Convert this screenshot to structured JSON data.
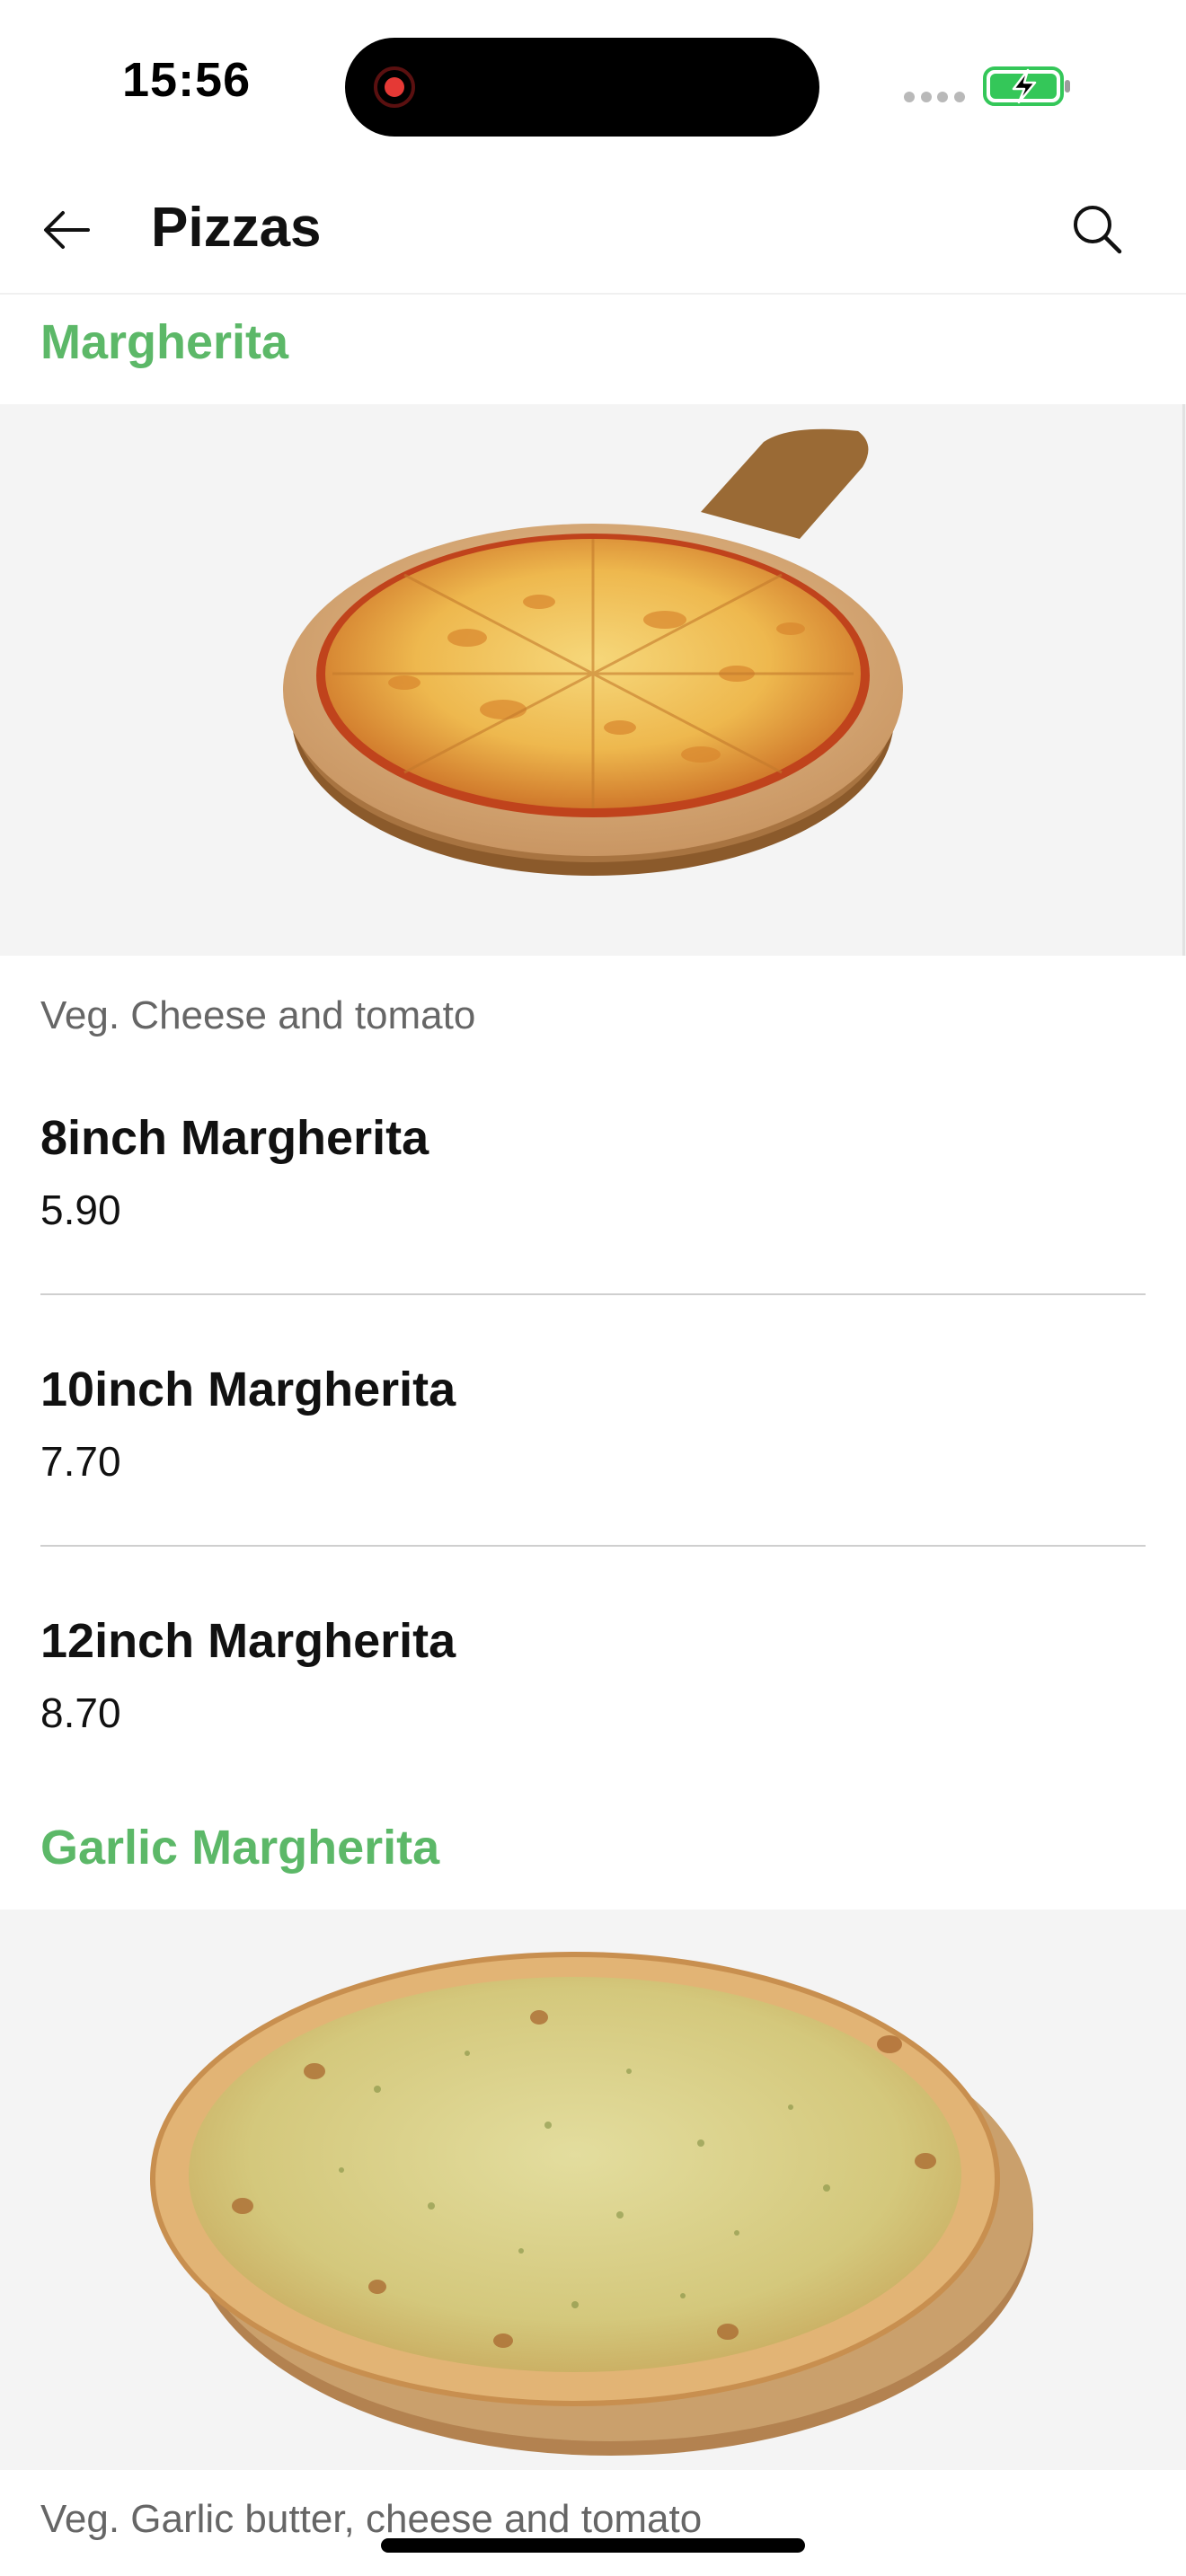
{
  "status_bar": {
    "time": "15:56",
    "recording_color": "#e53935",
    "battery_color": "#34c759"
  },
  "header": {
    "title": "Pizzas",
    "back_icon": "arrow-left-icon",
    "search_icon": "search-icon"
  },
  "accent_color": "#5cb868",
  "sections": [
    {
      "title": "Margherita",
      "image": "margherita-pizza-image",
      "description": "Veg. Cheese and tomato",
      "items": [
        {
          "name": "8inch Margherita",
          "price": "5.90"
        },
        {
          "name": "10inch Margherita",
          "price": "7.70"
        },
        {
          "name": "12inch Margherita",
          "price": "8.70"
        }
      ]
    },
    {
      "title": "Garlic Margherita",
      "image": "garlic-margherita-pizza-image",
      "description": "Veg. Garlic butter, cheese and tomato"
    }
  ]
}
